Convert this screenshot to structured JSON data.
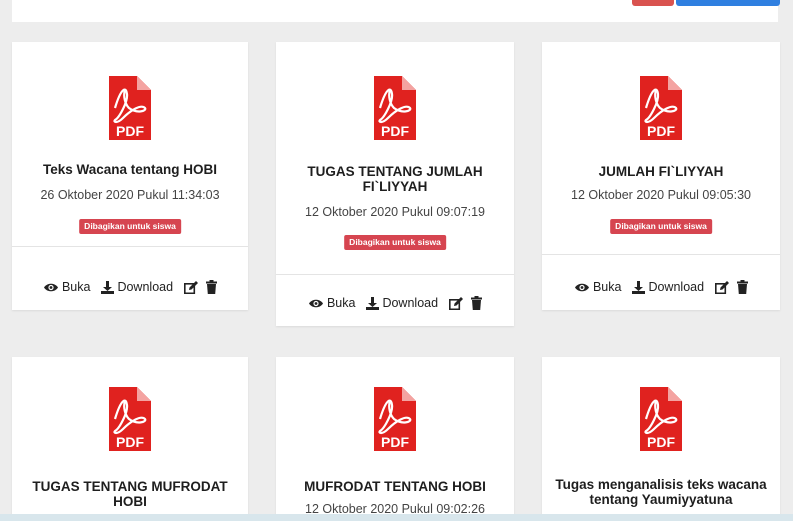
{
  "badge_label": "Dibagikan untuk siswa",
  "actions": {
    "open": "Buka",
    "download": "Download"
  },
  "pdf_label": "PDF",
  "colors": {
    "pdf_red": "#e0221f",
    "badge_red": "#d64550",
    "top_blue": "#2f7fe0",
    "top_red": "#d9534f"
  },
  "icons": {
    "file": "pdf-file-icon",
    "open": "eye-icon",
    "download": "download-icon",
    "edit": "edit-icon",
    "delete": "trash-icon"
  },
  "cards": [
    {
      "title": "Teks Wacana tentang HOBI",
      "date": "26 Oktober 2020 Pukul 11:34:03"
    },
    {
      "title": "TUGAS TENTANG JUMLAH FI`LIYYAH",
      "date": "12 Oktober 2020 Pukul 09:07:19"
    },
    {
      "title": "JUMLAH FI`LIYYAH",
      "date": "12 Oktober 2020 Pukul 09:05:30"
    },
    {
      "title": "TUGAS TENTANG MUFRODAT HOBI",
      "date": ""
    },
    {
      "title": "MUFRODAT TENTANG HOBI",
      "date": "12 Oktober 2020 Pukul 09:02:26"
    },
    {
      "title": "Tugas menganalisis teks wacana tentang Yaumiyyatuna",
      "date": ""
    }
  ]
}
